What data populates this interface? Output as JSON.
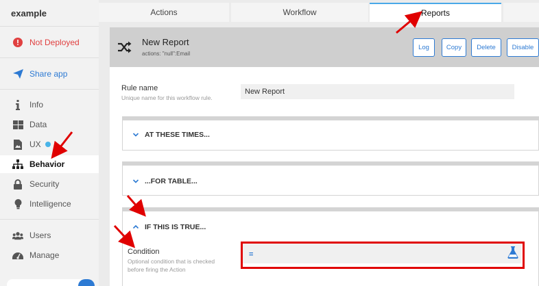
{
  "app": {
    "title": "example"
  },
  "sidebar": {
    "status": "Not Deployed",
    "share": "Share app",
    "items": [
      {
        "label": "Info",
        "icon": "info-icon"
      },
      {
        "label": "Data",
        "icon": "data-grid-icon"
      },
      {
        "label": "UX",
        "icon": "ux-image-icon"
      },
      {
        "label": "Behavior",
        "icon": "behavior-hierarchy-icon"
      },
      {
        "label": "Security",
        "icon": "lock-icon"
      },
      {
        "label": "Intelligence",
        "icon": "lightbulb-icon"
      },
      {
        "label": "Users",
        "icon": "users-icon"
      },
      {
        "label": "Manage",
        "icon": "dashboard-gauge-icon"
      }
    ],
    "active": "Behavior"
  },
  "tabs": [
    {
      "label": "Actions"
    },
    {
      "label": "Workflow"
    },
    {
      "label": "Reports"
    }
  ],
  "active_tab": "Reports",
  "report": {
    "title": "New Report",
    "subtitle": "actions: \"null\":Email",
    "buttons": {
      "log": "Log",
      "copy": "Copy",
      "delete": "Delete",
      "disable": "Disable"
    }
  },
  "rule_name": {
    "label": "Rule name",
    "help": "Unique name for this workflow rule.",
    "value": "New Report"
  },
  "sections": {
    "times": "AT THESE TIMES...",
    "table": "...FOR TABLE...",
    "condition": "IF THIS IS TRUE..."
  },
  "condition": {
    "label": "Condition",
    "help_line1": "Optional condition that is checked",
    "help_line2": "before firing the Action",
    "prefix": "="
  },
  "colors": {
    "accent": "#2d7ad3",
    "annotation": "#e00000",
    "alert": "#e04040",
    "tab_highlight": "#49a8e8"
  }
}
